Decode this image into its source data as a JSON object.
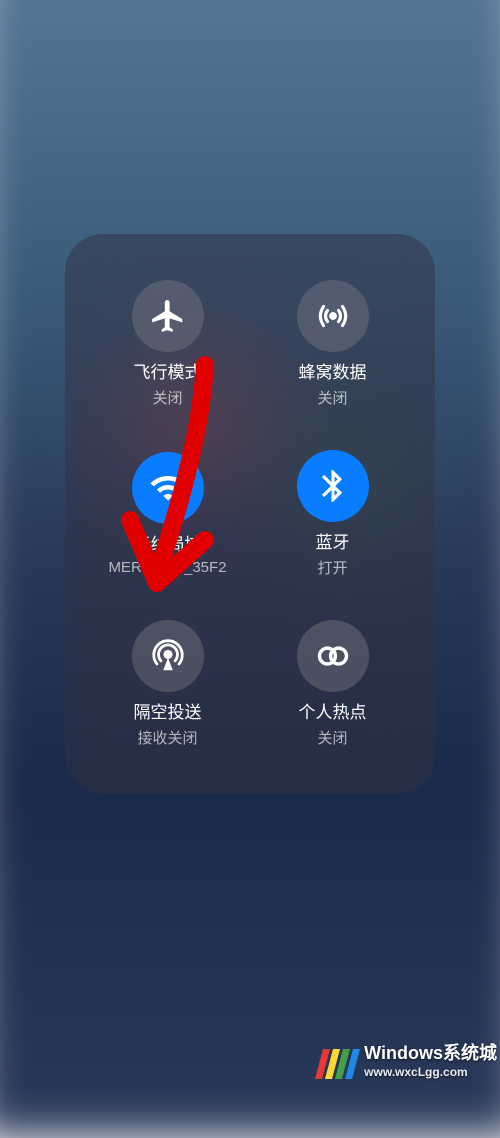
{
  "controls": {
    "airplane": {
      "title": "飞行模式",
      "status": "关闭",
      "active": false
    },
    "cellular": {
      "title": "蜂窝数据",
      "status": "关闭",
      "active": false
    },
    "wifi": {
      "title": "无线局域",
      "status": "MERCURY_35F2",
      "active": true
    },
    "bluetooth": {
      "title": "蓝牙",
      "status": "打开",
      "active": true
    },
    "airdrop": {
      "title": "隔空投送",
      "status": "接收关闭",
      "active": false
    },
    "hotspot": {
      "title": "个人热点",
      "status": "关闭",
      "active": false
    }
  },
  "watermark": {
    "title": "Windows系统城",
    "url": "www.wxcLgg.com",
    "bar_colors": [
      "#e53935",
      "#fdd835",
      "#43a047",
      "#1e88e5"
    ]
  }
}
